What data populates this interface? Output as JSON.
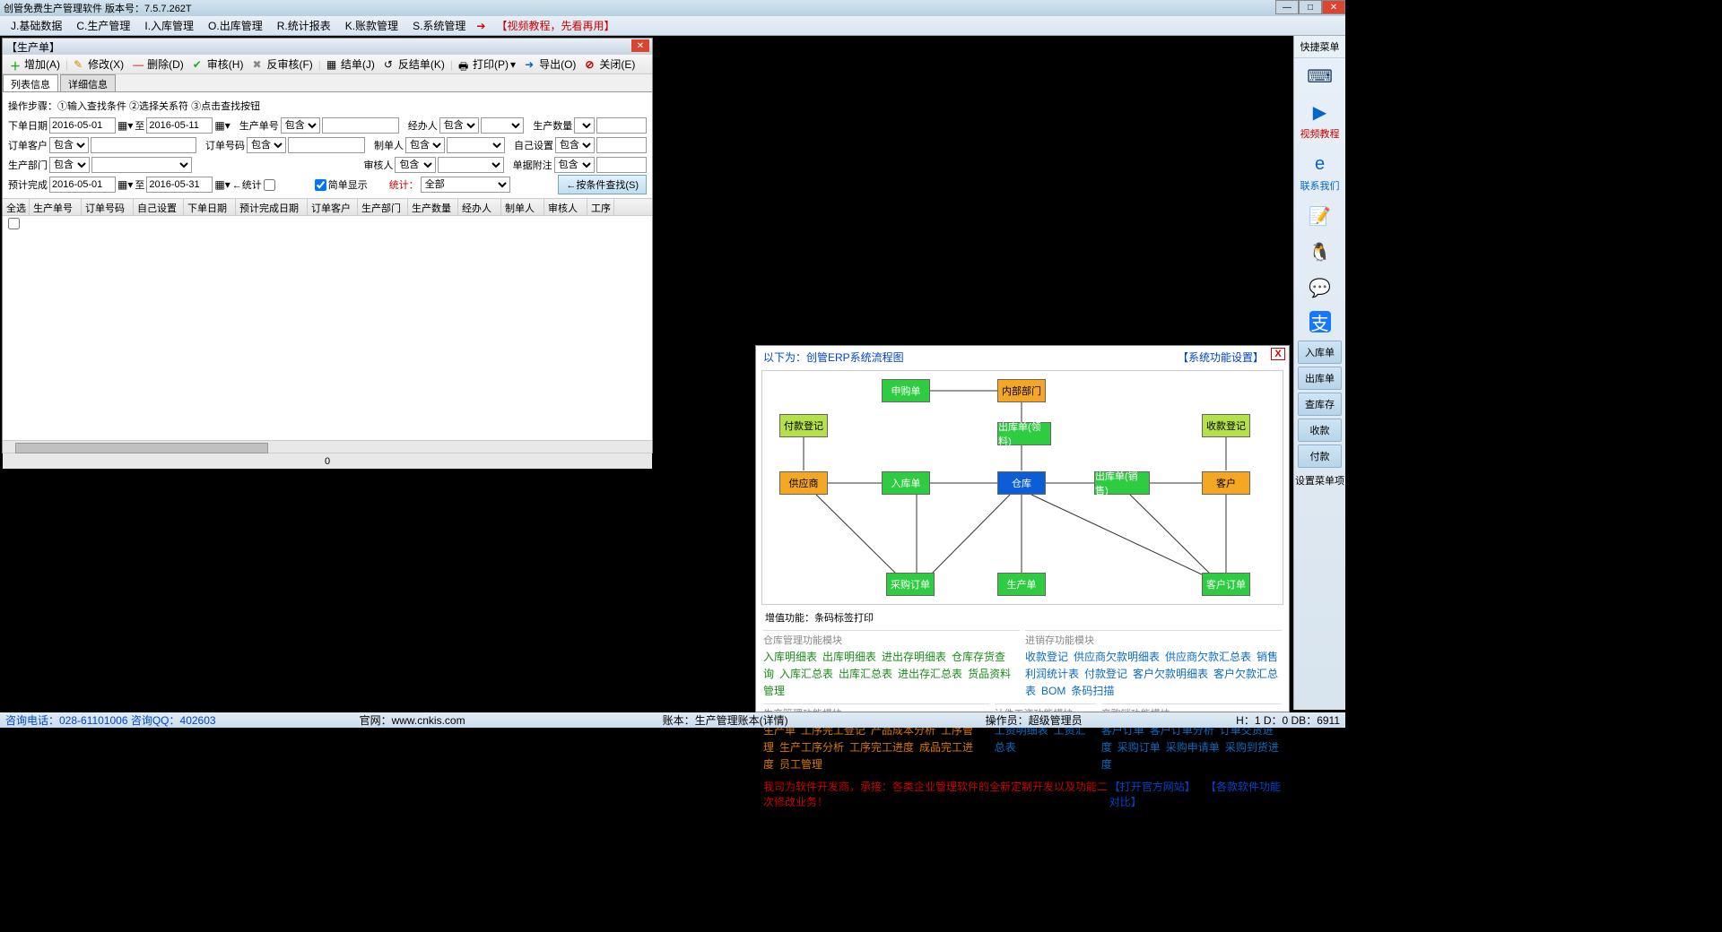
{
  "title": "创管免费生产管理软件 版本号：7.5.7.262T",
  "menu": {
    "j": "J.基础数据",
    "c": "C.生产管理",
    "i": "I.入库管理",
    "o": "O.出库管理",
    "r": "R.统计报表",
    "k": "K.账款管理",
    "s": "S.系统管理",
    "video": "【视频教程，先看再用】"
  },
  "panel": {
    "title": "【生产单】",
    "toolbar": {
      "add": "增加(A)",
      "edit": "修改(X)",
      "del": "删除(D)",
      "audit": "审核(H)",
      "unaudit": "反审核(F)",
      "close_order": "结单(J)",
      "unclose": "反结单(K)",
      "print": "打印(P)",
      "export": "导出(O)",
      "close": "关闭(E)"
    },
    "tabs": {
      "list": "列表信息",
      "detail": "详细信息"
    },
    "steps": "操作步骤：①输入查找条件 ②选择关系符 ③点击查找按钮",
    "filters": {
      "order_date": "下单日期",
      "d1": "2016-05-01",
      "to": "至",
      "d2": "2016-05-11",
      "prod_no": "生产单号",
      "contain": "包含",
      "handler": "经办人",
      "qty": "生产数量",
      "cust": "订单客户",
      "order_no": "订单号码",
      "maker": "制单人",
      "custom": "自己设置",
      "dept": "生产部门",
      "auditor": "审核人",
      "remark": "单据附注",
      "est": "预计完成",
      "d3": "2016-05-01",
      "d4": "2016-05-31",
      "stat": "←统计",
      "simple": "简单显示",
      "total": "统计：",
      "all": "全部",
      "search": "←按条件查找(S)"
    },
    "cols": {
      "sel": "全选",
      "pno": "生产单号",
      "ono": "订单号码",
      "cst": "自己设置",
      "odate": "下单日期",
      "edate": "预计完成日期",
      "ocust": "订单客户",
      "pdept": "生产部门",
      "pqty": "生产数量",
      "hand": "经办人",
      "mk": "制单人",
      "au": "审核人",
      "fl": "工序"
    },
    "footer_count": "0"
  },
  "sidebar": {
    "title": "快捷菜单",
    "video": "视频教程",
    "contact": "联系我们",
    "btns": {
      "in": "入库单",
      "out": "出库单",
      "stock": "查库存",
      "recv": "收款",
      "pay": "付款"
    },
    "set": "设置菜单项"
  },
  "flow": {
    "head_left": "以下为：创管ERP系统流程图",
    "head_right": "【系统功能设置】",
    "nodes": {
      "apply": "申购单",
      "dept": "内部部门",
      "payreg": "付款登记",
      "recvreg": "收款登记",
      "out_mat": "出库单(领料)",
      "supplier": "供应商",
      "in": "入库单",
      "wh": "仓库",
      "out_sale": "出库单(销售)",
      "cust": "客户",
      "po": "采购订单",
      "prod": "生产单",
      "so": "客户订单"
    },
    "vadd": "增值功能：条码标签打印",
    "mod_wh_t": "仓库管理功能模块",
    "mod_wh": [
      "入库明细表",
      "出库明细表",
      "进出存明细表",
      "仓库存货查询",
      "入库汇总表",
      "出库汇总表",
      "进出存汇总表",
      "货品资料管理"
    ],
    "mod_inv_t": "进销存功能模块",
    "mod_inv": [
      "收款登记",
      "供应商欠款明细表",
      "供应商欠款汇总表",
      "销售利润统计表",
      "付款登记",
      "客户欠款明细表",
      "客户欠款汇总表",
      "BOM",
      "条码扫描"
    ],
    "mod_prod_t": "生产管理功能模块",
    "mod_prod": [
      "生产单",
      "工序完工登记",
      "产品成本分析",
      "工序管理",
      "生产工序分析",
      "工序完工进度",
      "成品完工进度",
      "员工管理"
    ],
    "mod_pay_t": "计件工资功能模块",
    "mod_pay": [
      "工资明细表",
      "工资汇总表"
    ],
    "mod_ps_t": "产购销功能模块",
    "mod_ps": [
      "客户订单",
      "客户订单分析",
      "订单交货进度",
      "采购订单",
      "采购申请单",
      "采购到货进度"
    ],
    "foot_red": "我司为软件开发商，承接：各类企业管理软件的全新定制开发以及功能二次修改业务！",
    "foot_l1": "【打开官方网站】",
    "foot_l2": "【各款软件功能对比】"
  },
  "status": {
    "phone": "咨询电话：028-61101006 咨询QQ：402603",
    "site": "官网：www.cnkis.com",
    "acct": "账本：生产管理账本(详情)",
    "op": "操作员：超级管理员",
    "db": "H：1 D：0 DB：6911"
  }
}
